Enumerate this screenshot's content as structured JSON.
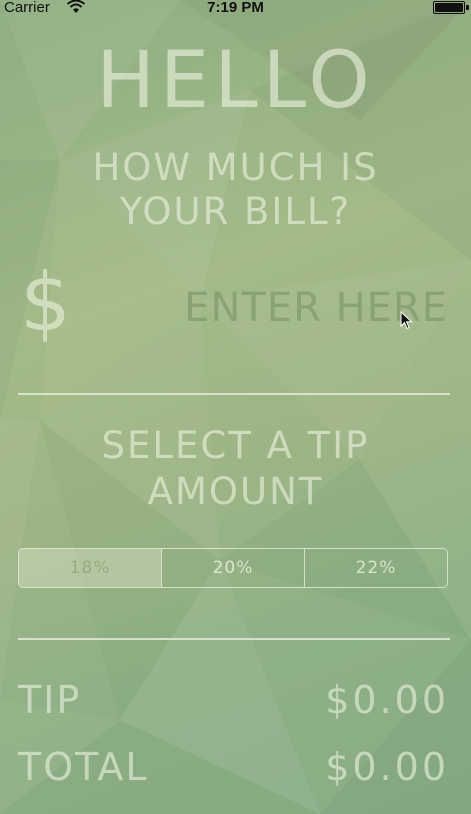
{
  "status_bar": {
    "carrier": "Carrier",
    "time": "7:19 PM",
    "icons": [
      "wifi-icon",
      "battery-icon"
    ]
  },
  "header": {
    "greeting": "HELLO",
    "question_line1": "HOW MUCH IS",
    "question_line2": "YOUR BILL?"
  },
  "bill": {
    "currency_symbol": "$",
    "input_value": "",
    "input_placeholder": "ENTER HERE"
  },
  "tip_selection": {
    "heading_line1": "SELECT A TIP",
    "heading_line2": "AMOUNT",
    "options": [
      "18%",
      "20%",
      "22%"
    ],
    "selected": "18%"
  },
  "results": {
    "tip_label": "TIP",
    "tip_value": "$0.00",
    "total_label": "TOTAL",
    "total_value": "$0.00"
  },
  "colors": {
    "background": "#9db585",
    "text": "#ecf2de",
    "status_text": "#111111"
  }
}
